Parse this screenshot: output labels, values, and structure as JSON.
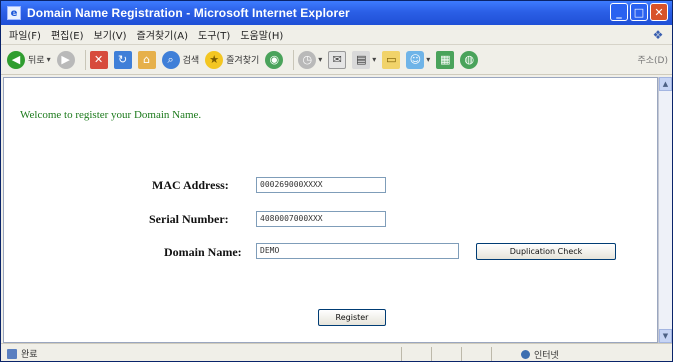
{
  "window": {
    "title": "Domain Name Registration - Microsoft Internet Explorer"
  },
  "menubar": {
    "items": [
      "파일(F)",
      "편집(E)",
      "보기(V)",
      "즐겨찾기(A)",
      "도구(T)",
      "도움말(H)"
    ]
  },
  "toolbar": {
    "back_label": "뒤로",
    "search_label": "검색",
    "favorites_label": "즐겨찾기",
    "right_label": "주소(D)"
  },
  "page": {
    "welcome_text": "Welcome to register your Domain Name.",
    "mac_label": "MAC Address:",
    "mac_value": "000269000XXXX",
    "serial_label": "Serial Number:",
    "serial_value": "4080007000XXX",
    "domain_label": "Domain Name:",
    "domain_value": "DEMO",
    "dup_check_label": "Duplication Check",
    "register_label": "Register"
  },
  "statusbar": {
    "left_text": "완료",
    "zone_text": "인터넷"
  }
}
